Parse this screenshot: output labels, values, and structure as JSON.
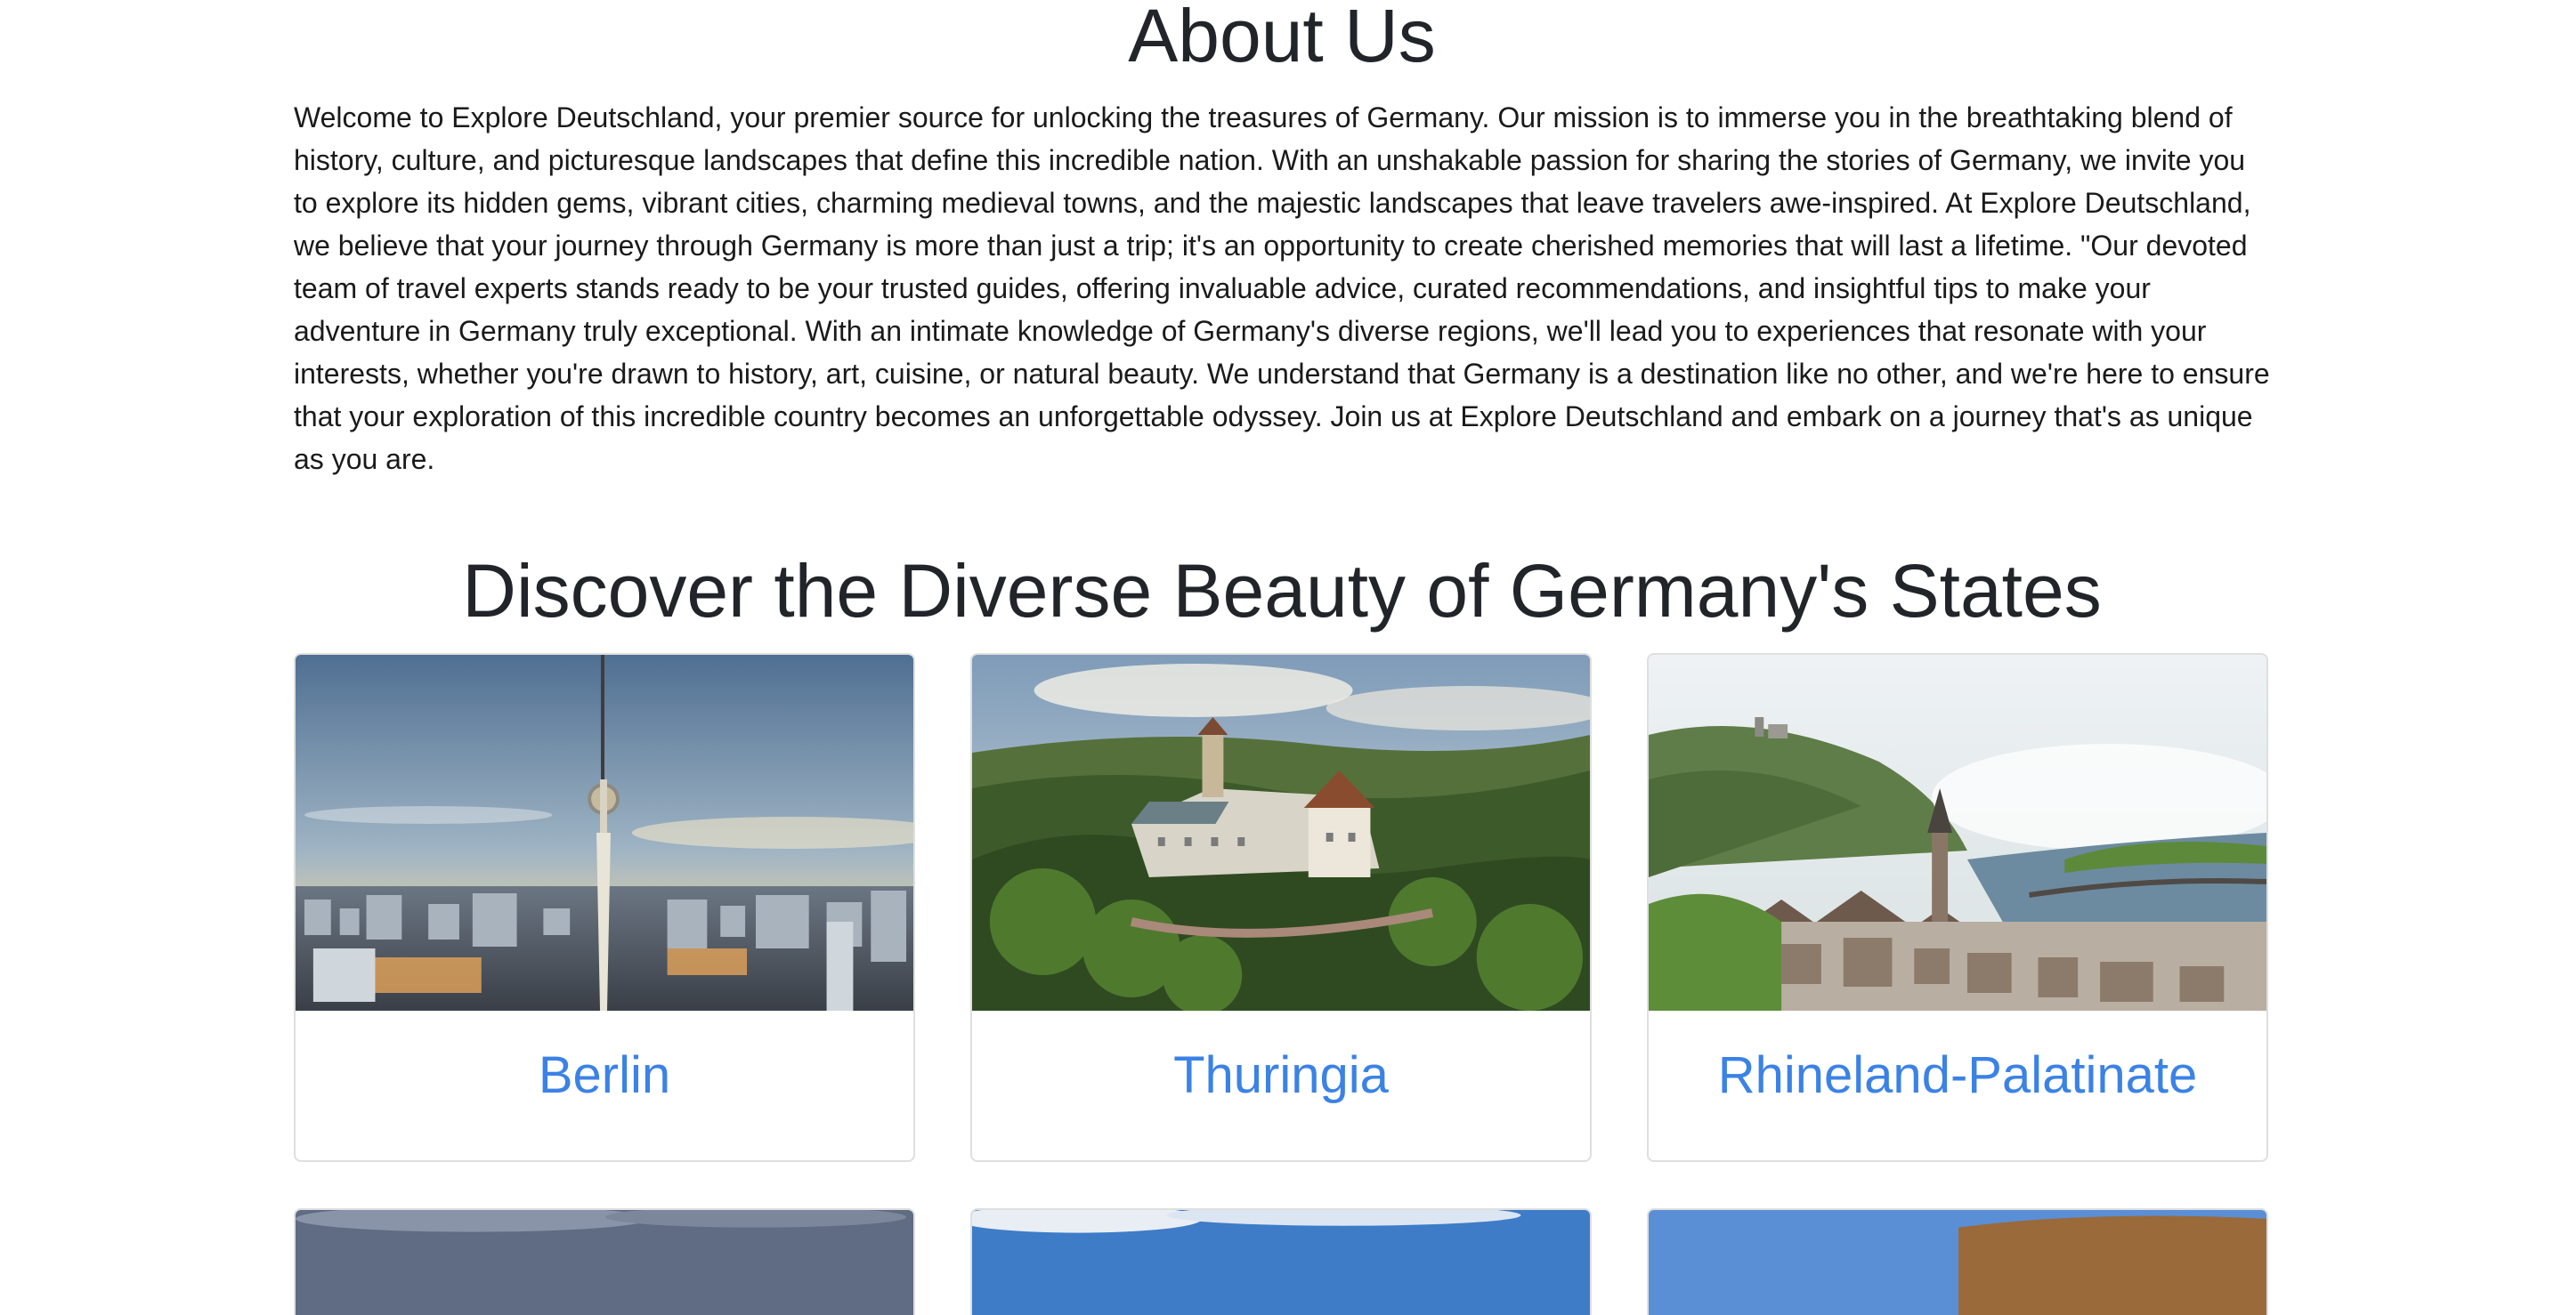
{
  "about": {
    "title": "About Us",
    "text": "Welcome to Explore Deutschland, your premier source for unlocking the treasures of Germany. Our mission is to immerse you in the breathtaking blend of history, culture, and picturesque landscapes that define this incredible nation. With an unshakable passion for sharing the stories of Germany, we invite you to explore its hidden gems, vibrant cities, charming medieval towns, and the majestic landscapes that leave travelers awe-inspired. At Explore Deutschland, we believe that your journey through Germany is more than just a trip; it's an opportunity to create cherished memories that will last a lifetime. \"Our devoted team of travel experts stands ready to be your trusted guides, offering invaluable advice, curated recommendations, and insightful tips to make your adventure in Germany truly exceptional. With an intimate knowledge of Germany's diverse regions, we'll lead you to experiences that resonate with your interests, whether you're drawn to history, art, cuisine, or natural beauty. We understand that Germany is a destination like no other, and we're here to ensure that your exploration of this incredible country becomes an unforgettable odyssey. Join us at Explore Deutschland and embark on a journey that's as unique as you are."
  },
  "states": {
    "title": "Discover the Diverse Beauty of Germany's States",
    "cards": [
      {
        "name": "Berlin"
      },
      {
        "name": "Thuringia"
      },
      {
        "name": "Rhineland-Palatinate"
      }
    ]
  },
  "colors": {
    "link": "#3b82e6",
    "text": "#212529"
  }
}
